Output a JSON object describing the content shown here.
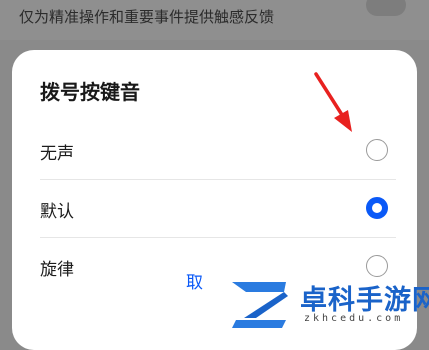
{
  "background": {
    "setting_text": "仅为精准操作和重要事件提供触感反馈"
  },
  "dialog": {
    "title": "拨号按键音",
    "options": [
      {
        "label": "无声",
        "selected": false
      },
      {
        "label": "默认",
        "selected": true
      },
      {
        "label": "旋律",
        "selected": false
      }
    ],
    "cancel_label": "取"
  },
  "watermark": {
    "name": "卓科手游网",
    "domain": "zkhcedu.com"
  },
  "colors": {
    "accent": "#0a59f7",
    "arrow": "#e8211f",
    "watermark": "#1a63c9"
  }
}
